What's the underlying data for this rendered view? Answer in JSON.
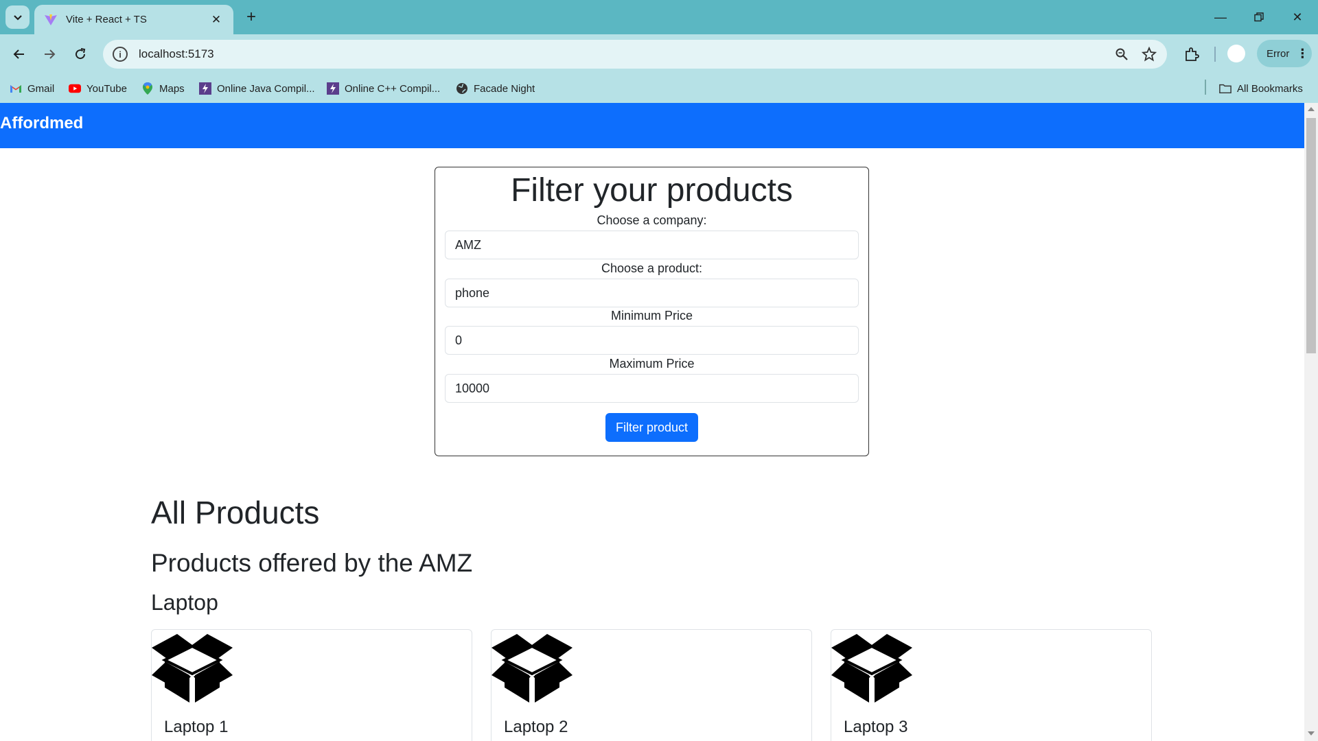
{
  "browser": {
    "tab_title": "Vite + React + TS",
    "url": "localhost:5173",
    "profile_label": "Error",
    "bookmarks": [
      {
        "label": "Gmail",
        "icon": "gmail-icon"
      },
      {
        "label": "YouTube",
        "icon": "youtube-icon"
      },
      {
        "label": "Maps",
        "icon": "maps-icon"
      },
      {
        "label": "Online Java Compil...",
        "icon": "bolt-icon"
      },
      {
        "label": "Online C++ Compil...",
        "icon": "bolt-icon"
      },
      {
        "label": "Facade Night",
        "icon": "globe-icon"
      }
    ],
    "all_bookmarks_label": "All Bookmarks"
  },
  "navbar": {
    "brand": "Affordmed",
    "color": "#0d6efd"
  },
  "filter": {
    "title": "Filter your products",
    "company_label": "Choose a company:",
    "company_value": "AMZ",
    "product_label": "Choose a product:",
    "product_value": "phone",
    "min_label": "Minimum Price",
    "min_value": "0",
    "max_label": "Maximum Price",
    "max_value": "10000",
    "button_label": "Filter product"
  },
  "products": {
    "heading": "All Products",
    "offered_heading": "Products offered by the AMZ",
    "category": "Laptop",
    "items": [
      {
        "name": "Laptop 1",
        "icon": "box-icon"
      },
      {
        "name": "Laptop 2",
        "icon": "box-icon"
      },
      {
        "name": "Laptop 3",
        "icon": "box-icon"
      }
    ]
  }
}
